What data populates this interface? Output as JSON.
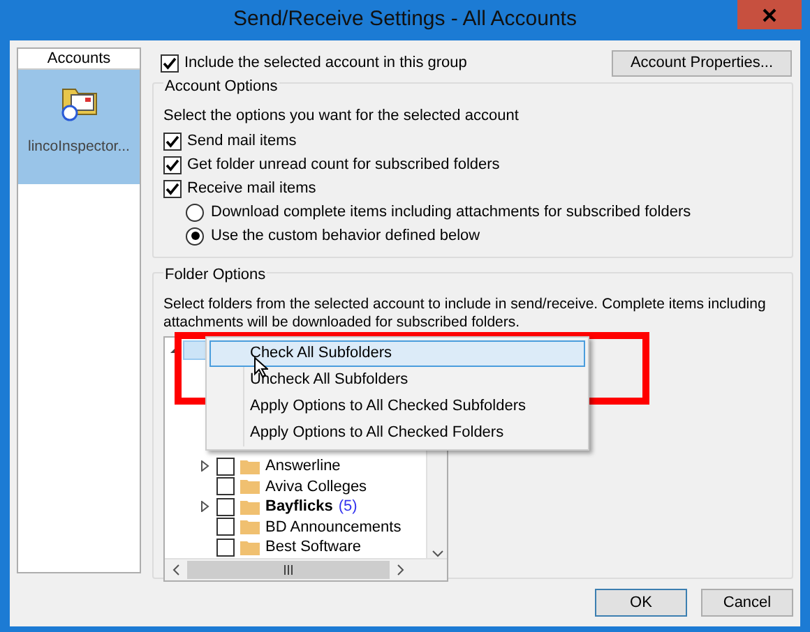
{
  "window": {
    "title": "Send/Receive Settings - All Accounts"
  },
  "accounts": {
    "header": "Accounts",
    "items": [
      {
        "label": "lincoInspector...",
        "selected": true
      }
    ]
  },
  "include_account": {
    "label": "Include the selected account in this group",
    "checked": true
  },
  "account_properties_button": "Account Properties...",
  "account_options": {
    "title": "Account Options",
    "prompt": "Select the options you want for the selected account",
    "items": [
      {
        "kind": "checkbox",
        "label": "Send mail items",
        "checked": true
      },
      {
        "kind": "checkbox",
        "label": "Get folder unread count for subscribed folders",
        "checked": true
      },
      {
        "kind": "checkbox",
        "label": "Receive mail items",
        "checked": true
      },
      {
        "kind": "radio",
        "label": "Download complete items including attachments for subscribed folders",
        "selected": false
      },
      {
        "kind": "radio",
        "label": "Use the custom behavior defined below",
        "selected": true
      }
    ]
  },
  "folder_options": {
    "title": "Folder Options",
    "description": "Select folders from the selected account to include in send/receive. Complete items including attachments will be downloaded for subscribed folders.",
    "tree": {
      "root": {
        "expanded": true,
        "selected": true
      },
      "items": [
        {
          "label": "Answerline",
          "has_children": true,
          "checked": false,
          "bold": false
        },
        {
          "label": "Aviva Colleges",
          "has_children": false,
          "checked": false,
          "bold": false
        },
        {
          "label": "Bayflicks",
          "count": "(5)",
          "has_children": true,
          "checked": false,
          "bold": true
        },
        {
          "label": "BD Announcements",
          "has_children": false,
          "checked": false,
          "bold": false
        },
        {
          "label": "Best Software",
          "has_children": false,
          "checked": false,
          "bold": false
        }
      ]
    }
  },
  "context_menu": {
    "items": [
      {
        "label": "Check All Subfolders",
        "selected": true
      },
      {
        "label": "Uncheck All Subfolders",
        "selected": false
      },
      {
        "label": "Apply Options to All Checked Subfolders",
        "selected": false
      },
      {
        "label": "Apply Options to All Checked Folders",
        "selected": false
      }
    ]
  },
  "buttons": [
    {
      "label": "OK",
      "default": true
    },
    {
      "label": "Cancel",
      "default": false
    }
  ]
}
